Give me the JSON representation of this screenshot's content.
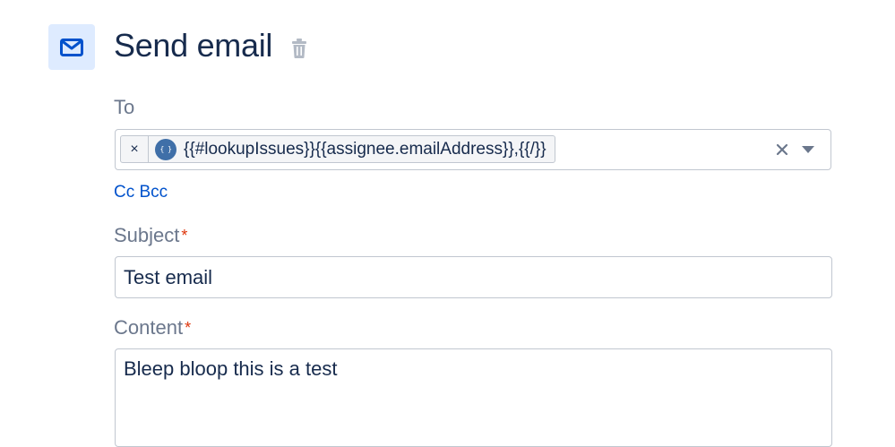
{
  "header": {
    "title": "Send email",
    "icon": "mail-icon",
    "delete_icon": "trash-icon"
  },
  "to": {
    "label": "To",
    "chip": {
      "remove_symbol": "×",
      "badge_symbol": "{ }",
      "value": "{{#lookupIssues}}{{assignee.emailAddress}},{{/}}"
    },
    "clear_icon": "clear-icon",
    "dropdown_icon": "chevron-down-icon"
  },
  "cc_bcc_link": "Cc Bcc",
  "subject": {
    "label": "Subject",
    "required_mark": "*",
    "value": "Test email"
  },
  "content": {
    "label": "Content",
    "required_mark": "*",
    "value": "Bleep bloop this is a test"
  },
  "colors": {
    "title": "#172b4d",
    "label": "#6b778c",
    "link": "#0052cc",
    "required": "#de350b",
    "icon_tile_bg": "#deebff",
    "icon": "#0052cc",
    "chip_badge": "#3f6fa8",
    "border": "#c1c7d0"
  }
}
